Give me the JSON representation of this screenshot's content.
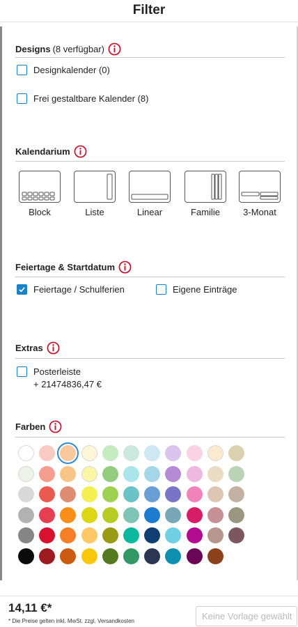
{
  "header": {
    "title": "Filter"
  },
  "designs": {
    "title": "Designs",
    "count": "(8 verfügbar)",
    "options": [
      {
        "label": "Designkalender (0)",
        "checked": false
      },
      {
        "label": "Frei gestaltbare Kalender (8)",
        "checked": false
      }
    ]
  },
  "kalendarium": {
    "title": "Kalendarium",
    "items": [
      {
        "label": "Block",
        "icon": "block-layout-icon"
      },
      {
        "label": "Liste",
        "icon": "list-layout-icon"
      },
      {
        "label": "Linear",
        "icon": "linear-layout-icon"
      },
      {
        "label": "Familie",
        "icon": "family-layout-icon"
      },
      {
        "label": "3-Monat",
        "icon": "three-month-layout-icon"
      }
    ]
  },
  "feiertage": {
    "title": "Feiertage & Startdatum",
    "options": [
      {
        "label": "Feiertage / Schulferien",
        "checked": true
      },
      {
        "label": "Eigene Einträge",
        "checked": false
      }
    ]
  },
  "extras": {
    "title": "Extras",
    "options": [
      {
        "label": "Posterleiste",
        "checked": false,
        "price": "+ 21474836,47 €"
      }
    ]
  },
  "farben": {
    "title": "Farben",
    "selected_index": 2,
    "swatches": [
      "#ffffff",
      "#f9c9c4",
      "#fbc79d",
      "#fdf6d8",
      "#c5ecc0",
      "#cbe8df",
      "#cde8f2",
      "#d8c4ec",
      "#f9d3e3",
      "#fde9cf",
      "#d9d1b0",
      "#eef1ea",
      "#f59e8f",
      "#f9c587",
      "#fbf5a6",
      "#93cc7f",
      "#a8e6ea",
      "#a4d6e8",
      "#b48ad6",
      "#eeb8e0",
      "#ebdac4",
      "#b9d3b4",
      "#d8d8d8",
      "#ea5a4f",
      "#de8d72",
      "#f5ef52",
      "#9ed14f",
      "#6cc3c7",
      "#6a9fd6",
      "#7a74c8",
      "#f083ba",
      "#ddc6b4",
      "#c2b0a2",
      "#b2b2b2",
      "#e53f51",
      "#fb8d19",
      "#dcd712",
      "#b7cb22",
      "#7ec5b8",
      "#1d7ccf",
      "#78a7b8",
      "#d81d67",
      "#c59196",
      "#9b9680",
      "#868686",
      "#d8112f",
      "#f67e26",
      "#fec767",
      "#9a9a14",
      "#0db99e",
      "#0f3e73",
      "#6ed0e2",
      "#b30c90",
      "#b7968d",
      "#7c5760",
      "#0b0b0b",
      "#9e1b1f",
      "#cc5a11",
      "#fbc70b",
      "#547a1f",
      "#339964",
      "#2b3652",
      "#0d90b0",
      "#6b0657",
      "#8c401c"
    ]
  },
  "footer": {
    "price": "14,11 €*",
    "note": "* Die Preise gelten inkl. MwSt. zzgl. Versandkosten",
    "button_label": "Keine Vorlage gewählt"
  }
}
